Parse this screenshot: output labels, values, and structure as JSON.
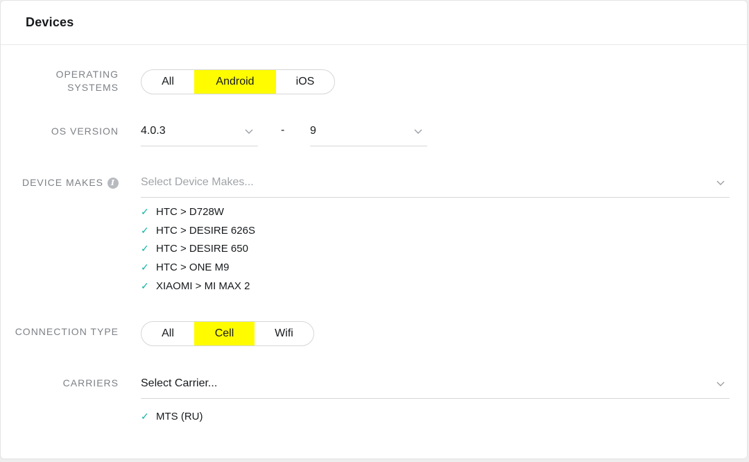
{
  "header": {
    "title": "Devices"
  },
  "operating_systems": {
    "label": "OPERATING SYSTEMS",
    "options": [
      "All",
      "Android",
      "iOS"
    ],
    "selected": "Android"
  },
  "os_version": {
    "label": "OS VERSION",
    "min": "4.0.3",
    "separator": "-",
    "max": "9"
  },
  "device_makes": {
    "label": "DEVICE MAKES",
    "info_icon": "info-icon",
    "placeholder": "Select Device Makes...",
    "selected": [
      "HTC > D728W",
      "HTC > DESIRE 626S",
      "HTC > DESIRE 650",
      "HTC > ONE M9",
      "XIAOMI > MI MAX 2"
    ]
  },
  "connection_type": {
    "label": "CONNECTION TYPE",
    "options": [
      "All",
      "Cell",
      "Wifi"
    ],
    "selected": "Cell"
  },
  "carriers": {
    "label": "CARRIERS",
    "placeholder": "Select Carrier...",
    "selected": [
      "MTS (RU)"
    ]
  },
  "colors": {
    "accent": "#fffc00",
    "check": "#14b3a5",
    "label": "#7d8186"
  }
}
